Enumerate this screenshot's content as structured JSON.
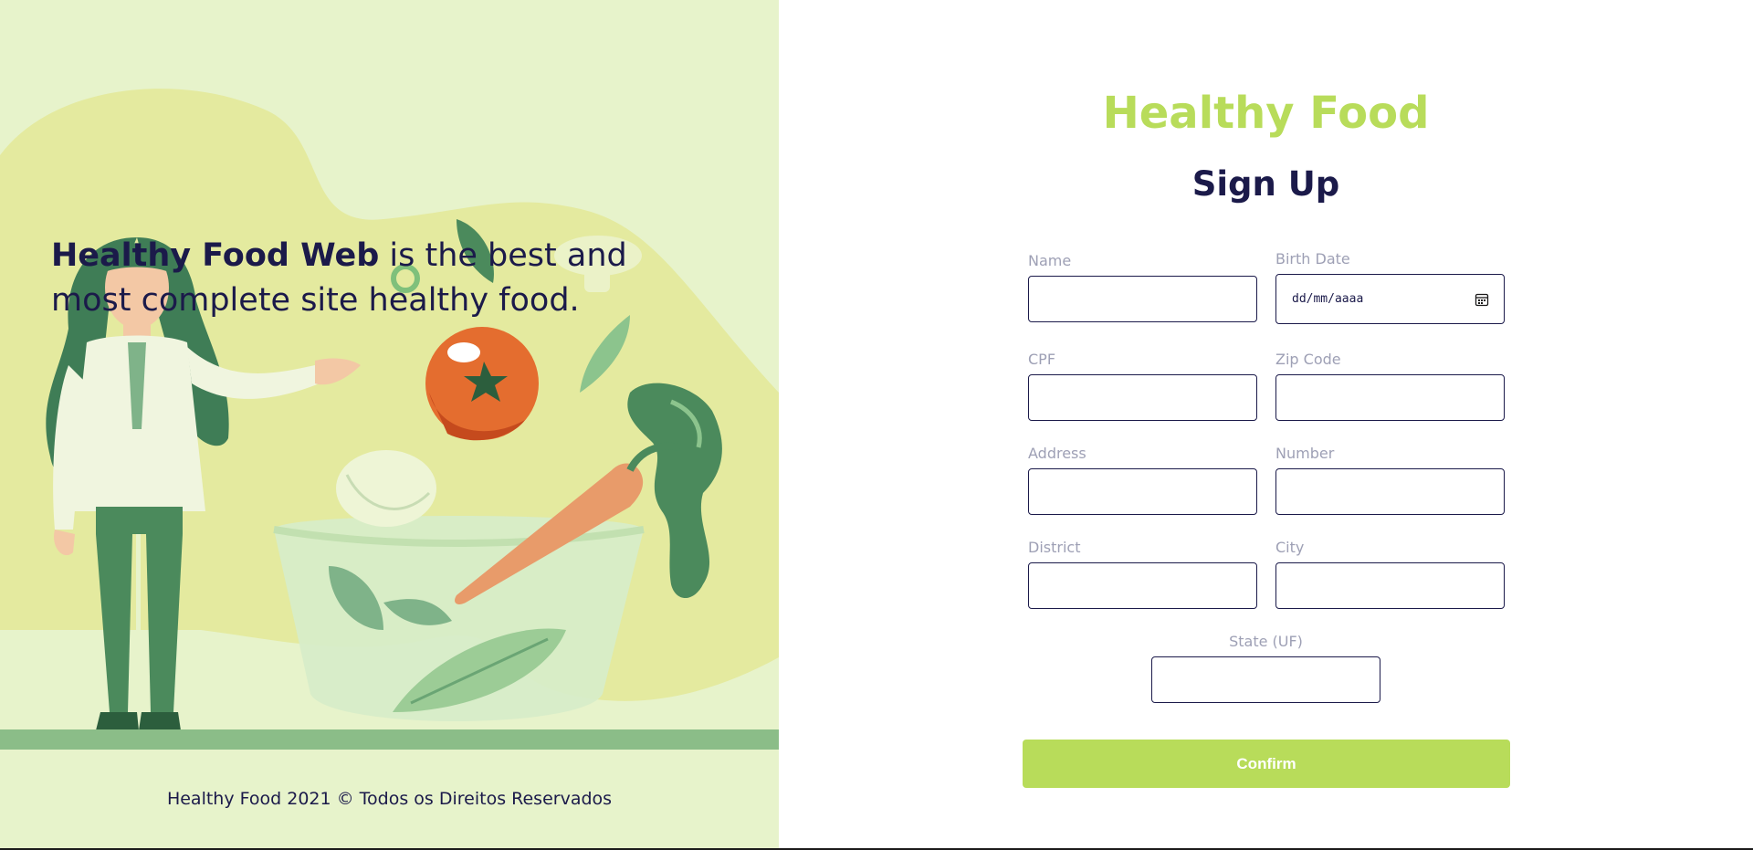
{
  "hero": {
    "tagline_bold": "Healthy Food Web",
    "tagline_rest": " is the best and most complete site healthy food.",
    "footer": "Healthy Food 2021 © Todos os Direitos Reservados"
  },
  "form": {
    "brand": "Healthy Food",
    "title": "Sign Up",
    "fields": {
      "name": {
        "label": "Name",
        "value": ""
      },
      "birth_date": {
        "label": "Birth Date",
        "placeholder": "dd/mm/aaaa"
      },
      "cpf": {
        "label": "CPF",
        "value": ""
      },
      "zip": {
        "label": "Zip Code",
        "value": ""
      },
      "address": {
        "label": "Address",
        "value": ""
      },
      "number": {
        "label": "Number",
        "value": ""
      },
      "district": {
        "label": "District",
        "value": ""
      },
      "city": {
        "label": "City",
        "value": ""
      },
      "state": {
        "label": "State (UF)",
        "value": ""
      }
    },
    "confirm_label": "Confirm"
  },
  "colors": {
    "accent": "#b8dc5a",
    "navy": "#1b1a4a",
    "panel_bg": "#e7f3cb",
    "label": "#9ea0b5"
  }
}
